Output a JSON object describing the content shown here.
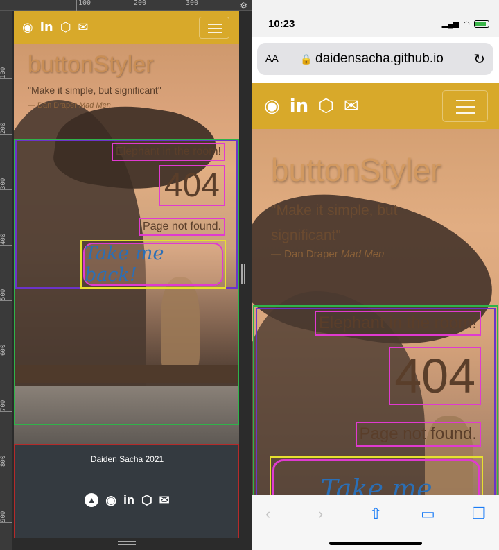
{
  "left_preview": {
    "ruler_ticks_top": [
      "100",
      "200",
      "300"
    ],
    "ruler_ticks_left": [
      "100",
      "200",
      "300",
      "400",
      "500",
      "600",
      "700",
      "800",
      "900"
    ],
    "nav_icons": [
      "github-icon",
      "linkedin-icon",
      "codepen-icon",
      "mail-icon"
    ],
    "title": "buttonStyler",
    "quote": "\"Make it simple, but significant\"",
    "author_prefix": "— Dan Draper ",
    "author_source": "Mad Men",
    "elephant_text": "Elephant in the room!",
    "error_code": "404",
    "not_found_text": "Page not found.",
    "back_button_label": "Take me back!",
    "footer_text": "Daiden Sacha 2021",
    "footer_icons": [
      "up-icon",
      "github-icon",
      "linkedin-icon",
      "codepen-icon",
      "mail-icon"
    ]
  },
  "phone": {
    "time": "10:23",
    "url_aa": "AA",
    "url": "daidensacha.github.io",
    "nav_icons": [
      "github-icon",
      "linkedin-icon",
      "codepen-icon",
      "mail-icon"
    ],
    "title": "buttonStyler",
    "quote": "\"Make it simple, but significant\"",
    "author_prefix": "— Dan Draper ",
    "author_source": "Mad Men",
    "elephant_text": "Elephant in the room!",
    "error_code": "404",
    "not_found_text": "Page not found.",
    "back_button_label": "Take me",
    "toolbar_icons": [
      "back-icon",
      "forward-icon",
      "share-icon",
      "bookmarks-icon",
      "tabs-icon"
    ]
  },
  "colors": {
    "navbar": "#d8a92a",
    "footer": "#343a40",
    "outline_green": "#2fb34a",
    "outline_purple": "#6b34c9",
    "outline_pink": "#e03ad0",
    "outline_yellow": "#e7e02f",
    "outline_red": "#b52a2a",
    "button_text": "#2a6fb7"
  }
}
